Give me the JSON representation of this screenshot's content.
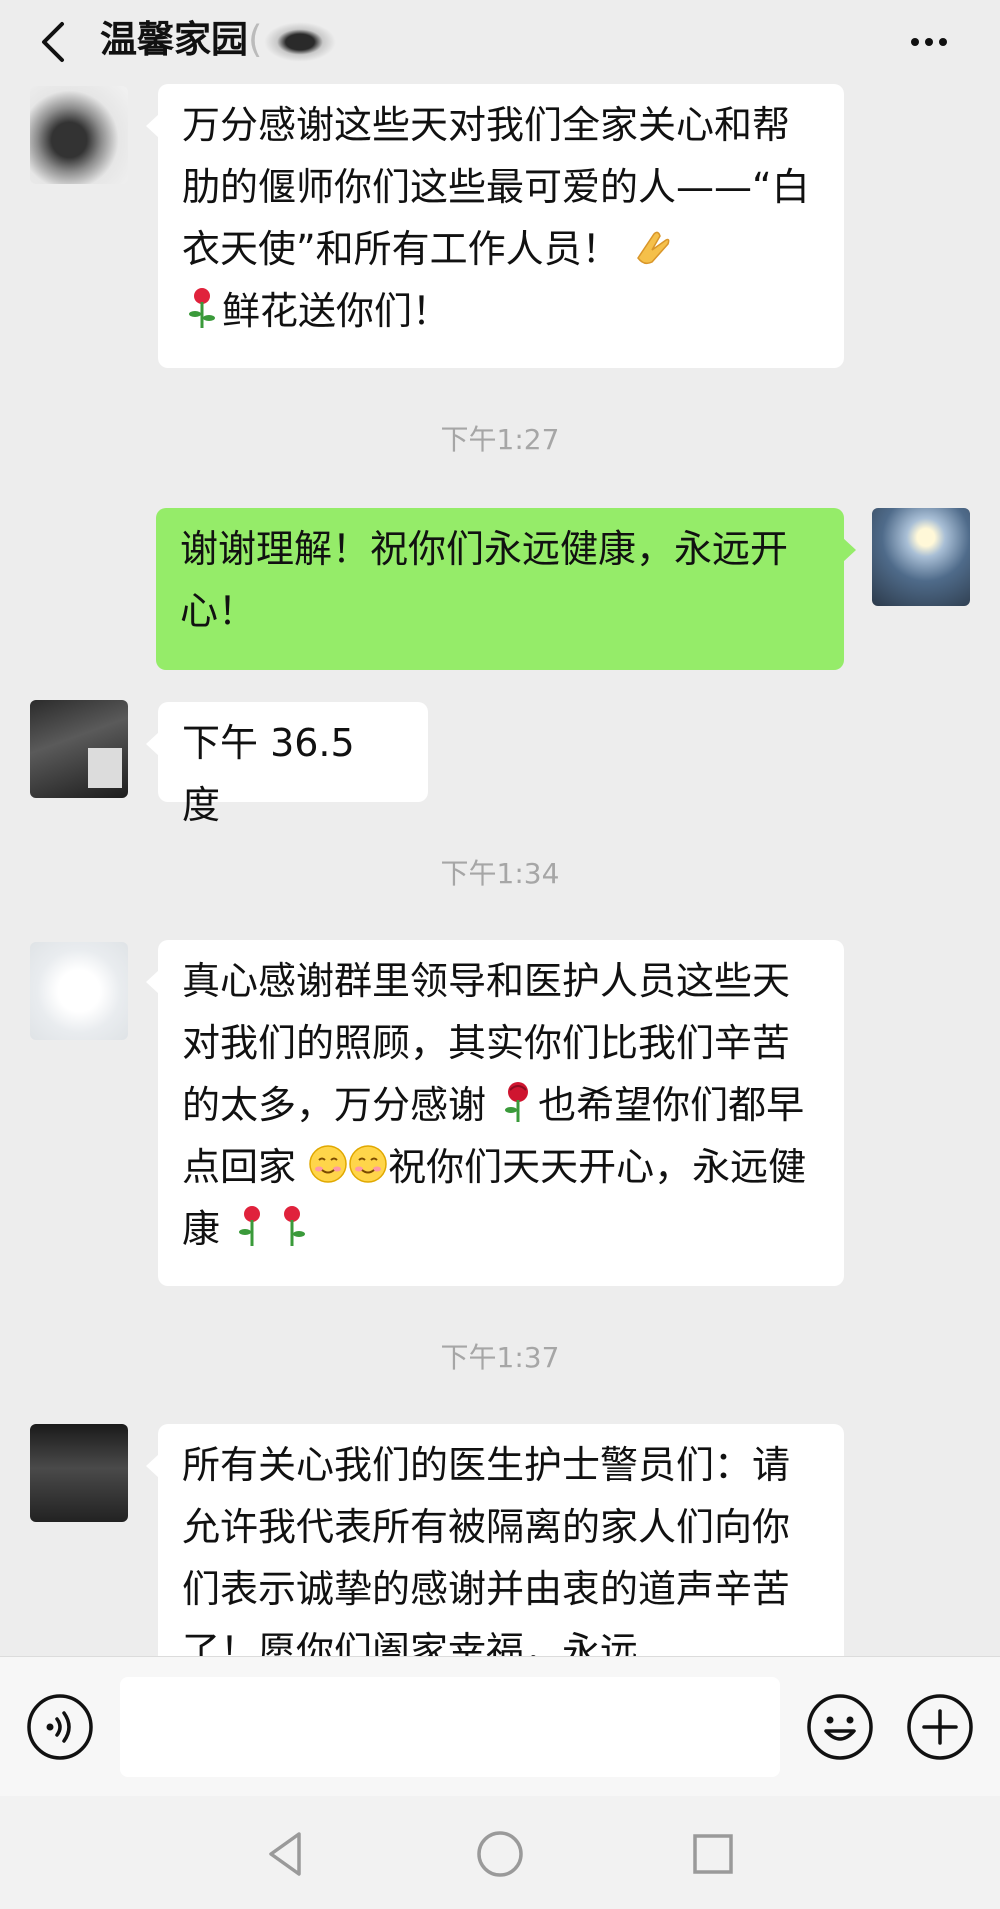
{
  "header": {
    "title": "温馨家园",
    "title_suffix": "(",
    "back_icon": "chevron-left-icon",
    "more_icon": "more-dots-icon"
  },
  "messages": [
    {
      "side": "left",
      "text": "万分感谢这些天对我们全家关心和帮肋的偃师你们这些最可爱的人——“白衣天使”和所有工作人员！",
      "line4": "鲜花送你们！",
      "emoji": [
        "clap-hands-icon",
        "rose-icon"
      ]
    },
    {
      "timestamp": "下午1:27"
    },
    {
      "side": "right",
      "text": "谢谢理解！祝你们永远健康，永远开心！"
    },
    {
      "side": "left",
      "text": "下午 36.5 度"
    },
    {
      "timestamp": "下午1:34"
    },
    {
      "side": "left",
      "text_a": "真心感谢群里领导和医护人员这些天对我们的照顾，其实你们比我们辛苦的太多，万分感谢",
      "text_b": "也希望你们都早点回家",
      "text_c": "祝你们天天开心，永远健康",
      "emoji": [
        "rose-icon",
        "smile-icon",
        "smile-icon",
        "rose-icon",
        "rose-icon"
      ]
    },
    {
      "timestamp": "下午1:37"
    },
    {
      "side": "left",
      "text": "所有关心我们的医生护士警员们：请允许我代表所有被隔离的家人们向你们表示诚挚的感谢并由衷的道声辛苦了！愿你们阖家幸福，永远"
    }
  ],
  "input_bar": {
    "placeholder": "",
    "voice_icon": "voice-icon",
    "emoji_icon": "emoji-icon",
    "plus_icon": "plus-icon"
  },
  "system_nav": {
    "back": "nav-back-triangle-icon",
    "home": "nav-home-circle-icon",
    "recent": "nav-recent-square-icon"
  },
  "colors": {
    "background": "#ededed",
    "bubble_self": "#95ec69",
    "bubble_other": "#ffffff",
    "timestamp": "#a6a6a6"
  }
}
